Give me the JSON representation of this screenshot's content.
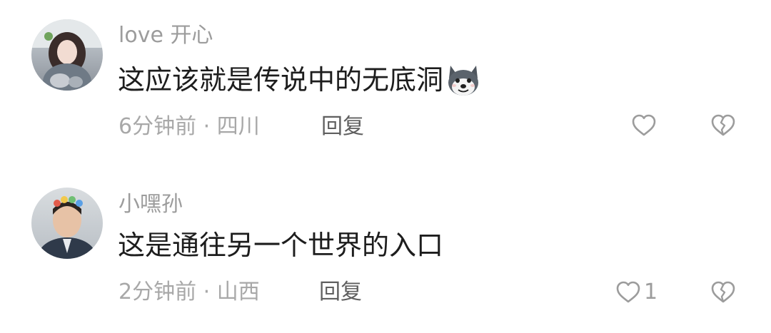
{
  "comments": [
    {
      "username": "love 开心",
      "text": "这应该就是传说中的无底洞",
      "emoji": "husky-dog-emoji",
      "time": "6分钟前",
      "location": "四川",
      "meta": "6分钟前 · 四川",
      "reply_label": "回复",
      "like_count": "",
      "avatar": "avatar-girl-photo"
    },
    {
      "username": "小嘿孙",
      "text": "这是通往另一个世界的入口",
      "time": "2分钟前",
      "location": "山西",
      "meta": "2分钟前 · 山西",
      "reply_label": "回复",
      "like_count": "1",
      "avatar": "avatar-man-photo"
    }
  ],
  "icons": {
    "like": "heart-outline-icon",
    "dislike": "broken-heart-icon"
  },
  "colors": {
    "username": "#9c9c9c",
    "text": "#1d1d1d",
    "meta": "#a8a8a8",
    "reply": "#5f5f5f",
    "icon": "#9c9c9c"
  }
}
